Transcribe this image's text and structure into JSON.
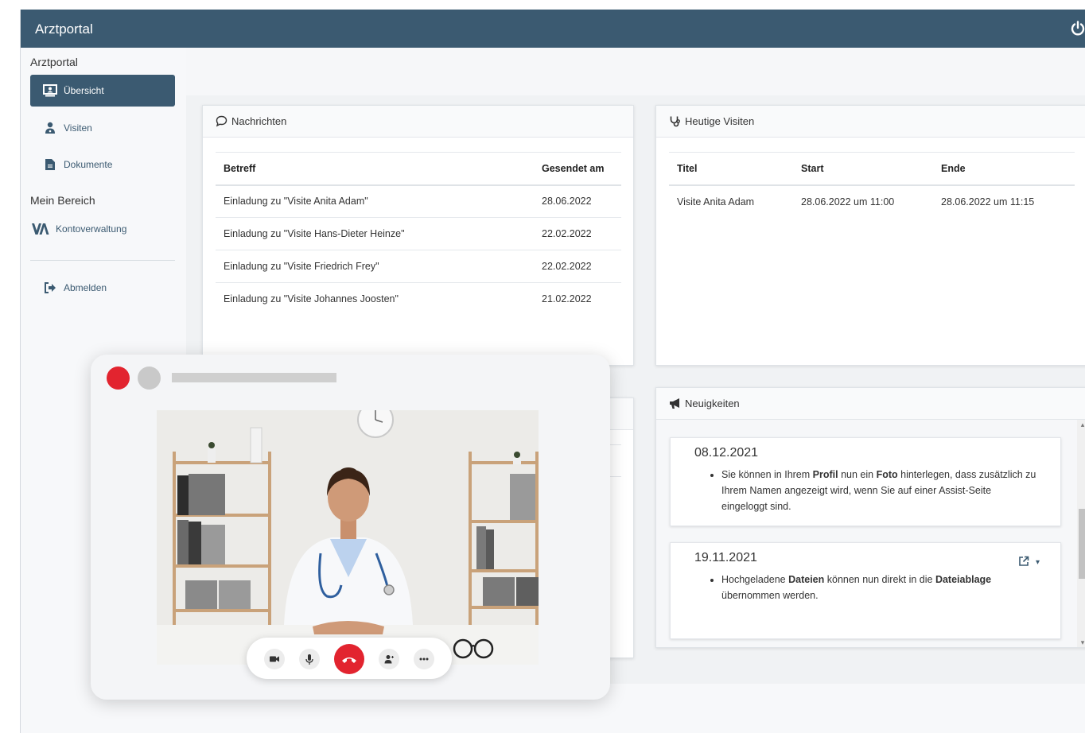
{
  "app": {
    "title": "Arztportal"
  },
  "sidebar": {
    "section1": "Arztportal",
    "section2": "Mein Bereich",
    "items": [
      {
        "label": "Übersicht",
        "icon": "monitor-user-icon",
        "active": true
      },
      {
        "label": "Visiten",
        "icon": "user-doctor-icon"
      },
      {
        "label": "Dokumente",
        "icon": "document-icon"
      },
      {
        "label": "Kontoverwaltung",
        "icon": "va-logo"
      },
      {
        "label": "Abmelden",
        "icon": "logout-icon"
      }
    ]
  },
  "messages": {
    "title": "Nachrichten",
    "columns": [
      "Betreff",
      "Gesendet am"
    ],
    "rows": [
      [
        "Einladung zu \"Visite Anita Adam\"",
        "28.06.2022"
      ],
      [
        "Einladung zu \"Visite Hans-Dieter Heinze\"",
        "22.02.2022"
      ],
      [
        "Einladung zu \"Visite Friedrich Frey\"",
        "22.02.2022"
      ],
      [
        "Einladung zu \"Visite Johannes Joosten\"",
        "21.02.2022"
      ]
    ]
  },
  "visits": {
    "title": "Heutige Visiten",
    "columns": [
      "Titel",
      "Start",
      "Ende"
    ],
    "rows": [
      [
        "Visite Anita Adam",
        "28.06.2022 um 11:00",
        "28.06.2022 um 11:15"
      ]
    ]
  },
  "news": {
    "title": "Neuigkeiten",
    "items": [
      {
        "date": "08.12.2021",
        "p1": "Sie können in Ihrem ",
        "b1": "Profil",
        "p2": " nun ein ",
        "b2": "Foto",
        "p3": " hinterlegen, dass zusätzlich zu Ihrem Namen angezeigt wird, wenn Sie auf einer Assist-Seite eingeloggt sind."
      },
      {
        "date": "19.11.2021",
        "p1": "Hochgeladene ",
        "b1": "Dateien",
        "p2": " können nun direkt in die ",
        "b2": "Dateiablage",
        "p3": " übernommen werden."
      }
    ]
  },
  "colors": {
    "primary": "#3b5a71",
    "danger": "#e2242f"
  }
}
